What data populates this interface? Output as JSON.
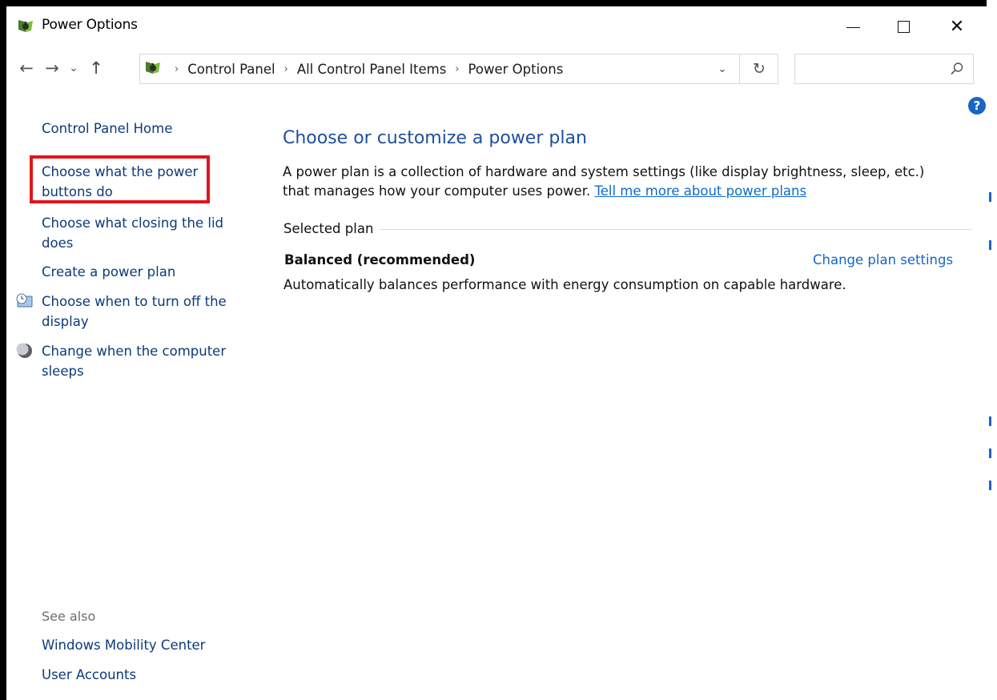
{
  "window": {
    "title": "Power Options",
    "controls": {
      "minimize": "minimize",
      "maximize": "maximize",
      "close": "✕"
    }
  },
  "nav": {
    "back": "←",
    "forward": "→",
    "recent": "⌄",
    "up": "↑",
    "breadcrumbs": [
      "Control Panel",
      "All Control Panel Items",
      "Power Options"
    ],
    "separator": "›",
    "dropdown": "⌄",
    "refresh": "↻",
    "search_placeholder": ""
  },
  "help": {
    "label": "?"
  },
  "sidebar": {
    "home": "Control Panel Home",
    "links": [
      "Choose what the power buttons do",
      "Choose what closing the lid does",
      "Create a power plan",
      "Choose when to turn off the display",
      "Change when the computer sleeps"
    ],
    "highlighted_index": 0,
    "see_also": {
      "heading": "See also",
      "links": [
        "Windows Mobility Center",
        "User Accounts"
      ]
    }
  },
  "main": {
    "title": "Choose or customize a power plan",
    "description": "A power plan is a collection of hardware and system settings (like display brightness, sleep, etc.) that manages how your computer uses power.",
    "learn_more_link": "Tell me more about power plans",
    "section_label": "Selected plan",
    "plan": {
      "name": "Balanced (recommended)",
      "settings_link": "Change plan settings",
      "description": "Automatically balances performance with energy consumption on capable hardware."
    }
  },
  "colors": {
    "link": "#0d3a7a",
    "title": "#1e4e9c",
    "accent": "#1766c4",
    "highlight": "#e0151c"
  }
}
